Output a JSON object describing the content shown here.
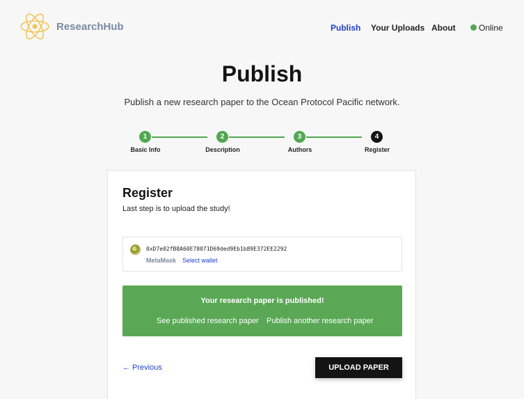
{
  "header": {
    "brand": "ResearchHub",
    "nav": [
      {
        "label": "Publish"
      },
      {
        "label": "Your Uploads"
      },
      {
        "label": "About"
      }
    ],
    "status": {
      "label": "Online",
      "color": "#52a852"
    },
    "logo_icon": "atom-icon"
  },
  "page": {
    "title": "Publish",
    "subtitle": "Publish a new research paper to the Ocean Protocol Pacific network."
  },
  "stepper": {
    "steps": [
      {
        "number": "1",
        "label": "Basic Info"
      },
      {
        "number": "2",
        "label": "Description"
      },
      {
        "number": "3",
        "label": "Authors"
      },
      {
        "number": "4",
        "label": "Register"
      }
    ]
  },
  "card": {
    "title": "Register",
    "subtitle": "Last step is to upload the study!",
    "wallet": {
      "address": "0xD7e02fB8A60E78071D69ded9Eb1b89E372EE2292",
      "provider": "MetaMask",
      "select_label": "Select wallet"
    },
    "success": {
      "title": "Your research paper is published!",
      "see_link": "See published research paper",
      "another_link": "Publish another research paper"
    },
    "previous_label": "← Previous",
    "upload_label": "UPLOAD PAPER"
  },
  "colors": {
    "accent": "#1f3fcc",
    "success": "#5aa856",
    "step_done": "#52a852",
    "step_current": "#141414"
  }
}
